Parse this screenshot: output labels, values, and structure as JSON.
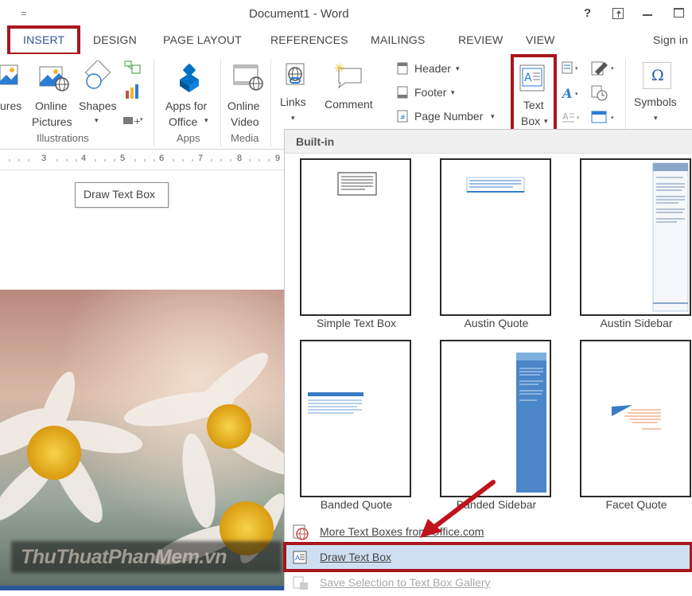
{
  "window": {
    "title": "Document1 - Word",
    "help": "?",
    "quick_access": "="
  },
  "tabs": [
    {
      "label": "INSERT"
    },
    {
      "label": "DESIGN"
    },
    {
      "label": "PAGE LAYOUT"
    },
    {
      "label": "REFERENCES"
    },
    {
      "label": "MAILINGS"
    },
    {
      "label": "REVIEW"
    },
    {
      "label": "VIEW"
    }
  ],
  "sign_in": "Sign in",
  "ribbon": {
    "pictures_partial": "ures",
    "online_pictures": [
      "Online",
      "Pictures"
    ],
    "shapes": "Shapes",
    "apps_for_office": [
      "Apps for",
      "Office"
    ],
    "online_video": [
      "Online",
      "Video"
    ],
    "links": "Links",
    "comment": "Comment",
    "header": "Header",
    "footer": "Footer",
    "page_number": "Page Number",
    "text_box": [
      "Text",
      "Box"
    ],
    "symbols": "Symbols",
    "groups": {
      "illustrations": "Illustrations",
      "apps": "Apps",
      "media": "Media"
    },
    "omega": "Ω"
  },
  "ruler_ticks": [
    "3",
    "4",
    "5",
    "6",
    "7",
    "8",
    "9"
  ],
  "tooltip": "Draw Text Box",
  "gallery": {
    "header": "Built-in",
    "items": [
      {
        "label": "Simple Text Box"
      },
      {
        "label": "Austin Quote"
      },
      {
        "label": "Austin Sidebar"
      },
      {
        "label": "Banded Quote"
      },
      {
        "label": "Banded Sidebar"
      },
      {
        "label": "Facet Quote"
      }
    ],
    "menu": [
      {
        "label": "More Text Boxes from Office.com",
        "enabled": true
      },
      {
        "label": "Draw Text Box",
        "enabled": true,
        "highlighted": true
      },
      {
        "label": "Save Selection to Text Box Gallery",
        "enabled": false
      }
    ]
  },
  "watermark": "ThuThuatPhanMem.vn",
  "colors": {
    "highlight_red": "#a8161e",
    "arrow_red": "#c0141c",
    "accent_blue": "#2b579a",
    "menu_highlight": "#cfdff2"
  }
}
